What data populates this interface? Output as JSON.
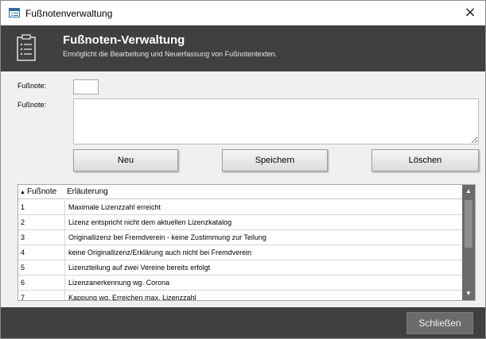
{
  "window": {
    "title": "Fußnotenverwaltung",
    "close_glyph": "×"
  },
  "header": {
    "title": "Fußnoten-Verwaltung",
    "subtitle": "Ermöglicht die Bearbeitung und Neuerfassung von Fußnotentexten.",
    "icon": "clipboard-list-icon"
  },
  "form": {
    "number_label": "Fußnote:",
    "number_value": "",
    "text_label": "Fußnote:",
    "text_value": ""
  },
  "actions": {
    "new_label": "Neu",
    "save_label": "Speichern",
    "delete_label": "Löschen"
  },
  "table": {
    "columns": [
      "Fußnote",
      "Erläuterung"
    ],
    "sort_glyph": "▲",
    "rows": [
      {
        "num": "1",
        "desc": "Maximale Lizenzzahl erreicht"
      },
      {
        "num": "2",
        "desc": "Lizenz entspricht nicht dem aktuellen Lizenzkatalog"
      },
      {
        "num": "3",
        "desc": "Originallizenz bei Fremdverein - keine Zustimmung zur Teilung"
      },
      {
        "num": "4",
        "desc": "keine Originallizenz/Erklärung auch nicht bei Fremdverein"
      },
      {
        "num": "5",
        "desc": "Lizenzteilung auf zwei Vereine bereits erfolgt"
      },
      {
        "num": "6",
        "desc": "Lizenzanerkennung wg. Corona"
      },
      {
        "num": "7",
        "desc": "Kappung wg. Erreichen max. Lizenzzahl"
      }
    ]
  },
  "footer": {
    "close_label": "Schließen"
  },
  "colors": {
    "header_bg": "#404040",
    "footer_bg": "#404040",
    "window_bg": "#f0f0f0"
  }
}
